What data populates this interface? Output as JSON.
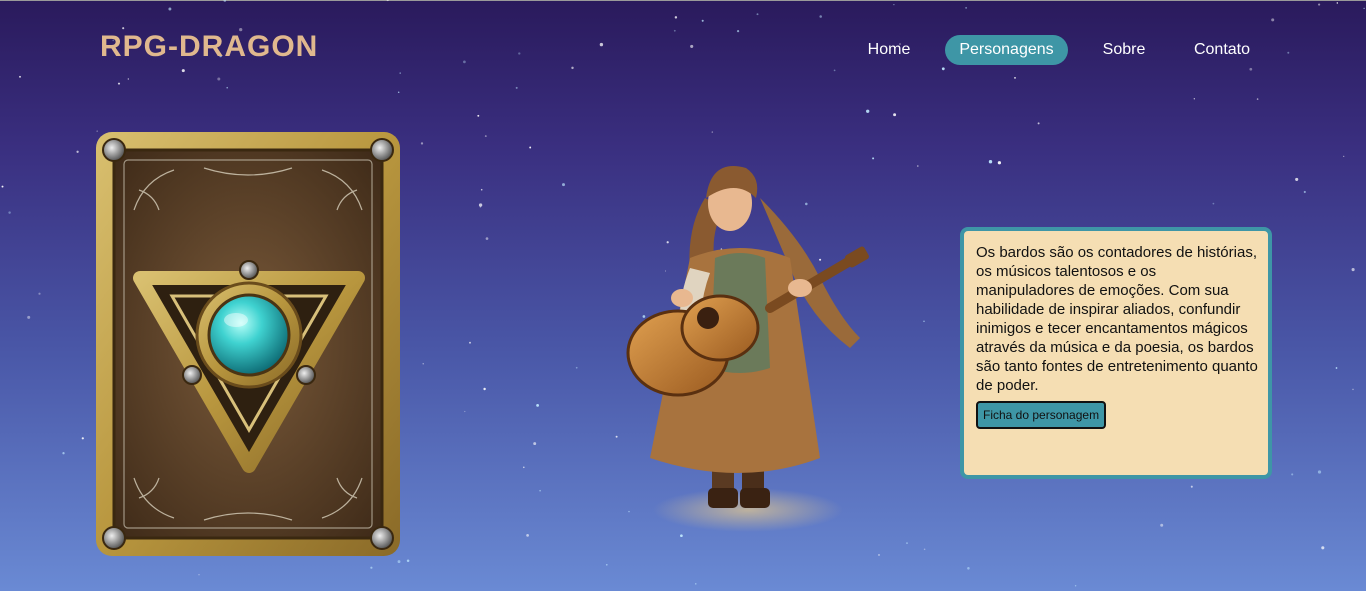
{
  "brand": {
    "logo_text": "RPG-DRAGON"
  },
  "nav": {
    "items": [
      {
        "label": "Home",
        "active": false
      },
      {
        "label": "Personagens",
        "active": true
      },
      {
        "label": "Sobre",
        "active": false
      },
      {
        "label": "Contato",
        "active": false
      }
    ]
  },
  "content": {
    "description": "Os bardos são os contadores de histórias, os músicos talentosos e os manipuladores de emoções. Com sua habilidade de inspirar aliados, confundir inimigos e tecer encantamentos mágicos através da música e da poesia, os bardos são tanto fontes de entretenimento quanto de poder.",
    "button_label": "Ficha do personagem"
  },
  "colors": {
    "accent": "#3e96a6",
    "logo": "#e0b88e",
    "box_background": "#f5deb3",
    "background_top": "#2a1a5c",
    "background_bottom": "#6a8ad4"
  }
}
